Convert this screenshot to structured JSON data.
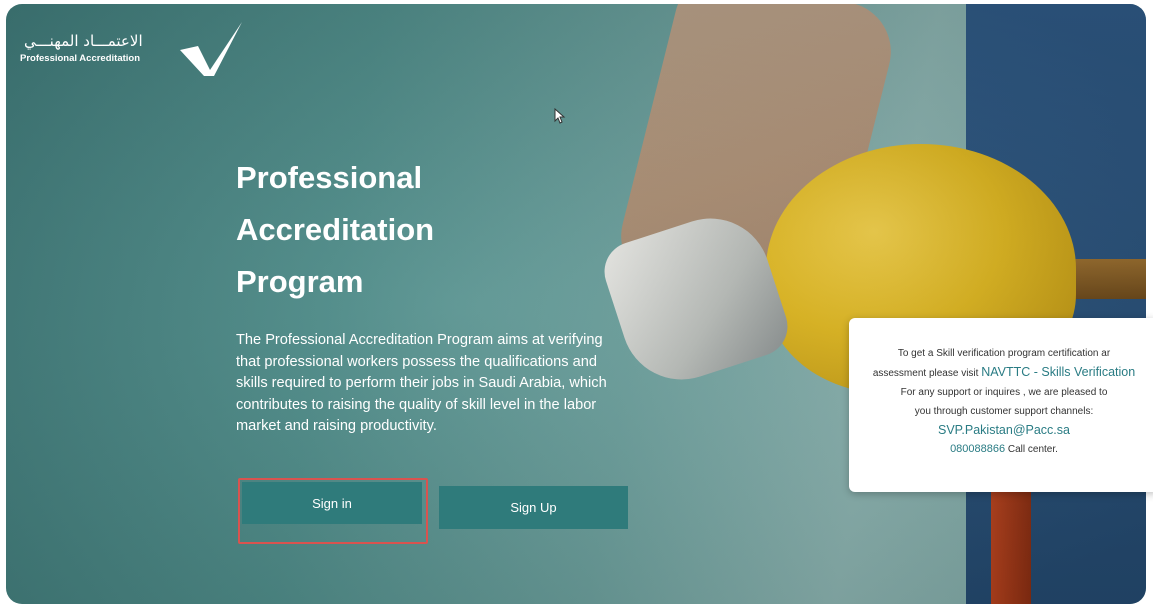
{
  "logo": {
    "arabic": "الاعتمـــاد المهنـــي",
    "english": "Professional Accreditation"
  },
  "hero": {
    "title_line1": "Professional",
    "title_line2": "Accreditation",
    "title_line3": "Program",
    "description": "The Professional Accreditation Program aims at verifying that professional workers possess the qualifications and skills required to perform their jobs in Saudi Arabia, which contributes to raising the quality of skill level in the labor market and raising productivity."
  },
  "buttons": {
    "sign_in": "Sign in",
    "sign_up": "Sign Up"
  },
  "info": {
    "line1": "To get a Skill verification program certification ar",
    "line2_prefix": "assessment please visit ",
    "line2_link": "NAVTTC - Skills Verification",
    "line3": "For any support or inquires , we are pleased to",
    "line4": "you through customer support channels:",
    "email": "SVP.Pakistan@Pacc.sa",
    "phone": "080088866",
    "phone_suffix": " Call center."
  },
  "colors": {
    "primary_teal": "#2f7b7b",
    "highlight_red": "#d9534f",
    "link_teal": "#2a7c84"
  }
}
